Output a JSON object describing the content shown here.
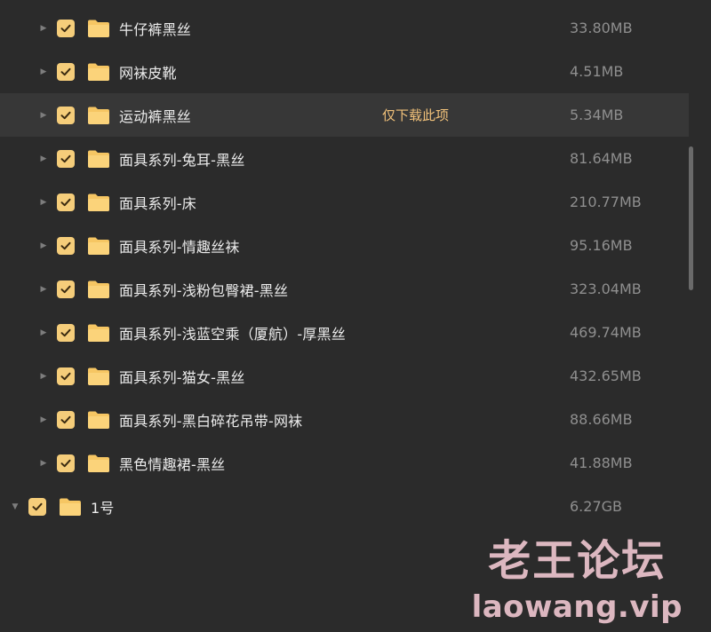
{
  "colors": {
    "background": "#2b2b2b",
    "hover_row": "#373737",
    "checkbox": "#f5cd7a",
    "folder": "#f6c663",
    "size_text": "#8f8f8f",
    "action_text": "#f2c27a"
  },
  "icons": {
    "expander_collapsed": "triangle-right-icon",
    "expander_expanded": "triangle-down-icon",
    "checkbox": "checkmark-icon",
    "folder": "folder-icon"
  },
  "files": [
    {
      "name": "牛仔裤黑丝",
      "size": "33.80MB"
    },
    {
      "name": "网袜皮靴",
      "size": "4.51MB"
    },
    {
      "name": "运动裤黑丝",
      "size": "5.34MB",
      "action": "仅下载此项"
    },
    {
      "name": "面具系列-兔耳-黑丝",
      "size": "81.64MB"
    },
    {
      "name": "面具系列-床",
      "size": "210.77MB"
    },
    {
      "name": "面具系列-情趣丝袜",
      "size": "95.16MB"
    },
    {
      "name": "面具系列-浅粉包臀裙-黑丝",
      "size": "323.04MB"
    },
    {
      "name": "面具系列-浅蓝空乘（厦航）-厚黑丝",
      "size": "469.74MB"
    },
    {
      "name": "面具系列-猫女-黑丝",
      "size": "432.65MB"
    },
    {
      "name": "面具系列-黑白碎花吊带-网袜",
      "size": "88.66MB"
    },
    {
      "name": "黑色情趣裙-黑丝",
      "size": "41.88MB"
    }
  ],
  "parent": {
    "name": "1号",
    "size": "6.27GB"
  },
  "watermark": {
    "name": "老王论坛",
    "url": "laowang.vip"
  }
}
